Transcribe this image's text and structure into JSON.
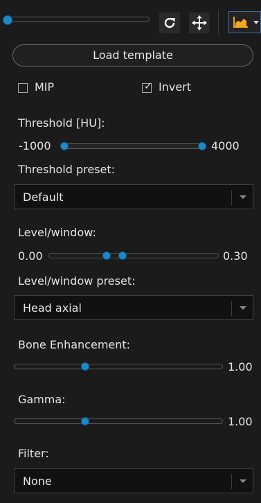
{
  "toolbar": {
    "rotate_icon": "rotate-icon",
    "move_icon": "move-icon",
    "histogram_icon": "histogram-icon",
    "accent": "#f5a623"
  },
  "load_template": "Load template",
  "mip": {
    "label": "MIP",
    "checked": false
  },
  "invert": {
    "label": "Invert",
    "checked": true,
    "mark": "✓"
  },
  "threshold": {
    "label": "Threshold [HU]:",
    "min_label": "-1000",
    "max_label": "4000"
  },
  "threshold_preset": {
    "label": "Threshold preset:",
    "value": "Default"
  },
  "level_window": {
    "label": "Level/window:",
    "min_label": "0.00",
    "max_label": "0.30"
  },
  "level_window_preset": {
    "label": "Level/window preset:",
    "value": "Head axial"
  },
  "bone_enhancement": {
    "label": "Bone Enhancement:",
    "value_label": "1.00"
  },
  "gamma": {
    "label": "Gamma:",
    "value_label": "1.00"
  },
  "filter": {
    "label": "Filter:",
    "value": "None"
  },
  "colors": {
    "knob": "#1e88c8",
    "panel": "#1b1b1b"
  }
}
